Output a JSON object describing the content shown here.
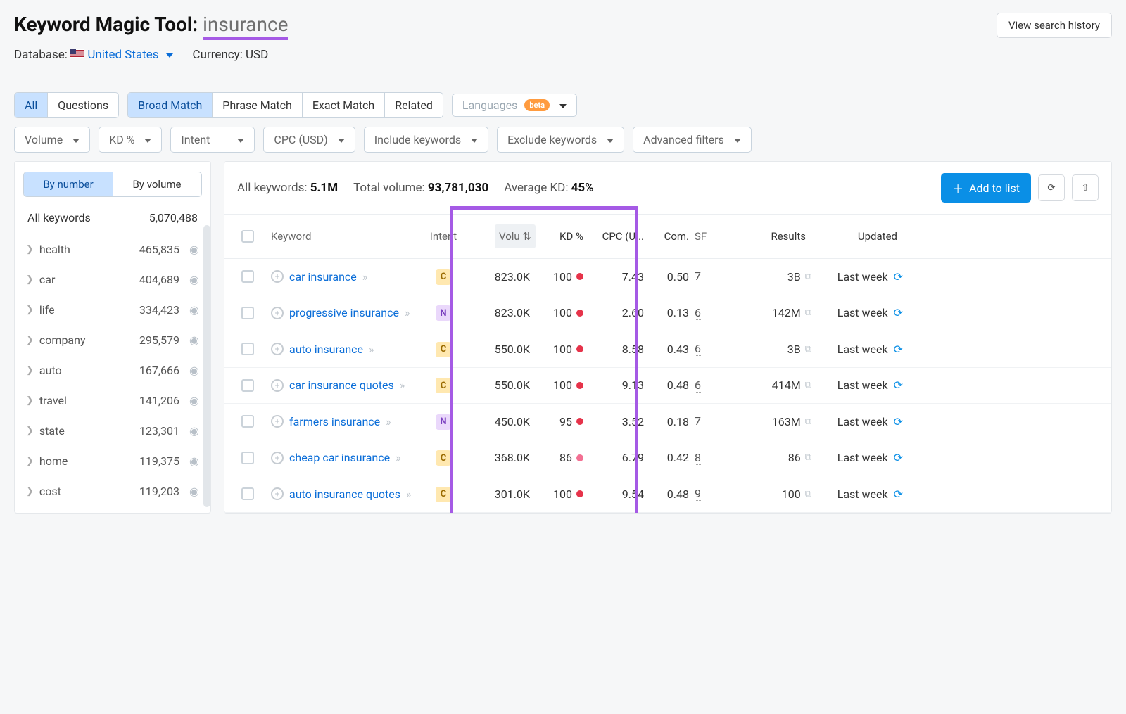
{
  "header": {
    "title_prefix": "Keyword Magic Tool:",
    "search_term": "insurance",
    "history_btn": "View search history",
    "db_label": "Database:",
    "db_value": "United States",
    "currency_label": "Currency: USD"
  },
  "match_tabs": {
    "all": "All",
    "questions": "Questions",
    "broad": "Broad Match",
    "phrase": "Phrase Match",
    "exact": "Exact Match",
    "related": "Related"
  },
  "lang": {
    "label": "Languages",
    "beta": "beta"
  },
  "filters": {
    "volume": "Volume",
    "kd": "KD %",
    "intent": "Intent",
    "cpc": "CPC (USD)",
    "include": "Include keywords",
    "exclude": "Exclude keywords",
    "advanced": "Advanced filters"
  },
  "sidebar": {
    "by_number": "By number",
    "by_volume": "By volume",
    "all_label": "All keywords",
    "all_count": "5,070,488",
    "items": [
      {
        "name": "health",
        "count": "465,835"
      },
      {
        "name": "car",
        "count": "404,689"
      },
      {
        "name": "life",
        "count": "334,423"
      },
      {
        "name": "company",
        "count": "295,579"
      },
      {
        "name": "auto",
        "count": "167,666"
      },
      {
        "name": "travel",
        "count": "141,206"
      },
      {
        "name": "state",
        "count": "123,301"
      },
      {
        "name": "home",
        "count": "119,375"
      },
      {
        "name": "cost",
        "count": "119,203"
      }
    ]
  },
  "stats": {
    "all_kw_label": "All keywords:",
    "all_kw_val": "5.1M",
    "tot_vol_label": "Total volume:",
    "tot_vol_val": "93,781,030",
    "avg_kd_label": "Average KD:",
    "avg_kd_val": "45%"
  },
  "actions": {
    "add": "Add to list"
  },
  "columns": {
    "keyword": "Keyword",
    "intent": "Intent",
    "volume": "Volu",
    "kd": "KD %",
    "cpc": "CPC (U...",
    "com": "Com.",
    "sf": "SF",
    "results": "Results",
    "updated": "Updated"
  },
  "rows": [
    {
      "kw": "car insurance",
      "intent": "C",
      "vol": "823.0K",
      "kd": "100",
      "kd_c": "red",
      "cpc": "7.43",
      "com": "0.50",
      "sf": "7",
      "res": "3B",
      "upd": "Last week"
    },
    {
      "kw": "progressive insurance",
      "intent": "N",
      "vol": "823.0K",
      "kd": "100",
      "kd_c": "red",
      "cpc": "2.60",
      "com": "0.13",
      "sf": "6",
      "res": "142M",
      "upd": "Last week"
    },
    {
      "kw": "auto insurance",
      "intent": "C",
      "vol": "550.0K",
      "kd": "100",
      "kd_c": "red",
      "cpc": "8.58",
      "com": "0.43",
      "sf": "6",
      "res": "3B",
      "upd": "Last week"
    },
    {
      "kw": "car insurance quotes",
      "intent": "C",
      "vol": "550.0K",
      "kd": "100",
      "kd_c": "red",
      "cpc": "9.13",
      "com": "0.48",
      "sf": "6",
      "res": "414M",
      "upd": "Last week"
    },
    {
      "kw": "farmers insurance",
      "intent": "N",
      "vol": "450.0K",
      "kd": "95",
      "kd_c": "red",
      "cpc": "3.52",
      "com": "0.18",
      "sf": "7",
      "res": "163M",
      "upd": "Last week"
    },
    {
      "kw": "cheap car insurance",
      "intent": "C",
      "vol": "368.0K",
      "kd": "86",
      "kd_c": "pink",
      "cpc": "6.79",
      "com": "0.42",
      "sf": "8",
      "res": "86",
      "upd": "Last week"
    },
    {
      "kw": "auto insurance quotes",
      "intent": "C",
      "vol": "301.0K",
      "kd": "100",
      "kd_c": "red",
      "cpc": "9.54",
      "com": "0.48",
      "sf": "9",
      "res": "100",
      "upd": "Last week"
    }
  ]
}
